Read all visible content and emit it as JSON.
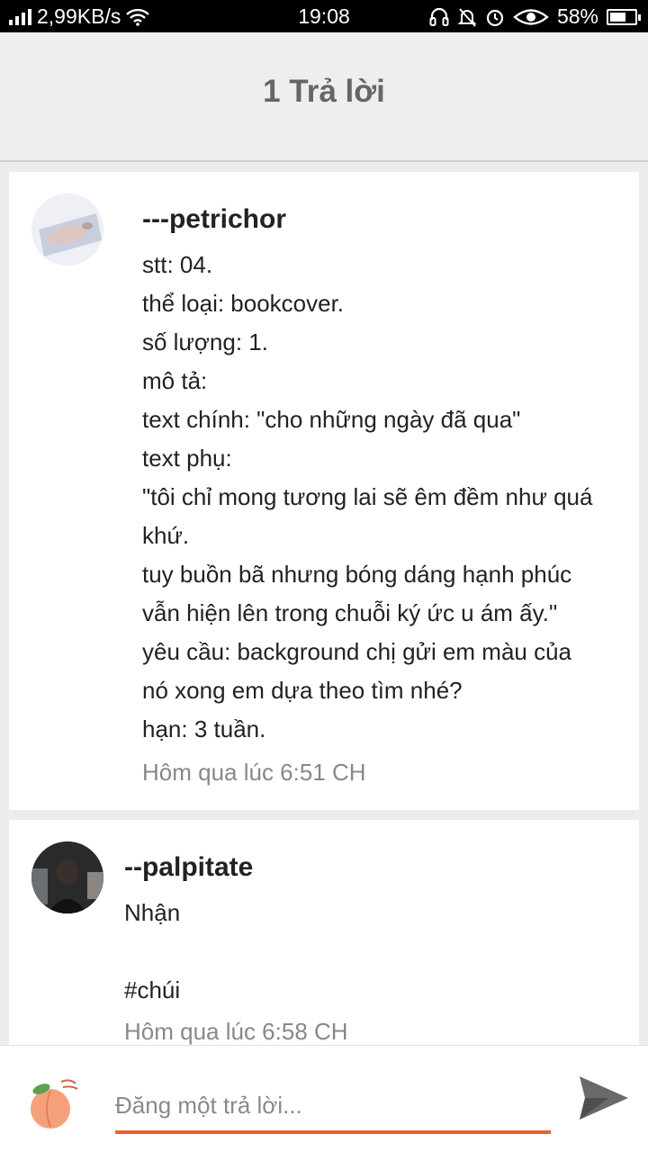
{
  "status_bar": {
    "speed": "2,99KB/s",
    "time": "19:08",
    "battery": "58%",
    "battery_level": 0.58
  },
  "header": {
    "title": "1 Trả lời"
  },
  "comments": [
    {
      "username": "---petrichor",
      "lines": [
        "stt: 04.",
        "thể loại: bookcover.",
        "số lượng: 1.",
        "mô tả:",
        "text chính: \"cho những ngày đã qua\"",
        "text phụ:",
        "\"tôi chỉ mong tương lai sẽ êm đềm như quá",
        "khứ.",
        "tuy buồn bã nhưng bóng dáng hạnh phúc",
        "vẫn hiện lên trong chuỗi ký ức u ám ấy.\"",
        "yêu cầu: background chị gửi em màu của",
        "nó xong em dựa theo tìm nhé?",
        "hạn: 3 tuần."
      ],
      "time": "Hôm qua lúc 6:51 CH"
    },
    {
      "username": "--palpitate",
      "lines": [
        "Nhận",
        "",
        "#chúi"
      ],
      "time": "Hôm qua lúc 6:58 CH"
    }
  ],
  "reply": {
    "placeholder": "Đăng một trả lời...",
    "accent": "#e8632a"
  },
  "icons": [
    "signal-icon",
    "wifi-icon",
    "headset-icon",
    "bell-off-icon",
    "alarm-icon",
    "eye-icon",
    "battery-icon",
    "send-icon"
  ]
}
